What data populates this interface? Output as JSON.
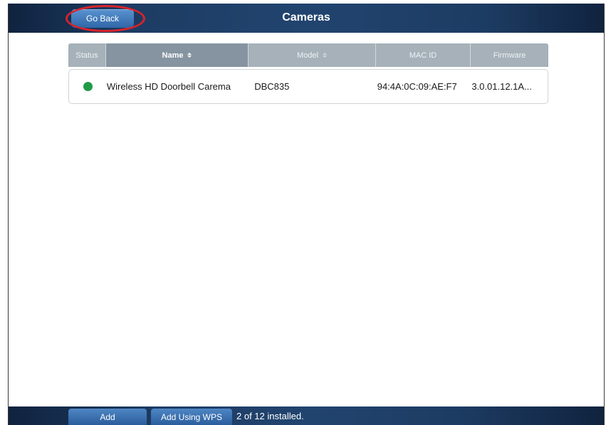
{
  "header": {
    "title": "Cameras",
    "back_label": "Go Back"
  },
  "table": {
    "columns": [
      {
        "key": "status",
        "label": "Status",
        "sorted": false,
        "sortable": false
      },
      {
        "key": "name",
        "label": "Name",
        "sorted": true,
        "sortable": true
      },
      {
        "key": "model",
        "label": "Model",
        "sorted": false,
        "sortable": true
      },
      {
        "key": "mac",
        "label": "MAC ID",
        "sorted": false,
        "sortable": false
      },
      {
        "key": "firmware",
        "label": "Firmware",
        "sorted": false,
        "sortable": false
      }
    ],
    "rows": [
      {
        "status": "online",
        "status_color": "#1f9a48",
        "name": "Wireless HD Doorbell Carema",
        "model": "DBC835",
        "mac": "94:4A:0C:09:AE:F7",
        "firmware": "3.0.01.12.1A..."
      }
    ]
  },
  "footer": {
    "add_label": "Add",
    "add_wps_label": "Add Using WPS",
    "installed_text": "2 of 12 installed."
  },
  "colors": {
    "header_bg": "#21446f",
    "button_blue": "#2f67a8",
    "highlight_ring": "#d9232a",
    "sorted_header": "#8594a0",
    "header_cell": "#a6b1b9"
  }
}
